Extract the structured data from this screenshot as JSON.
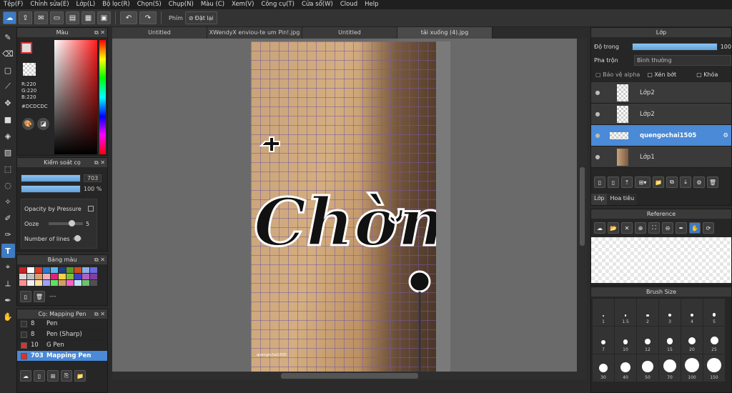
{
  "menu": [
    "Tệp(F)",
    "Chỉnh sửa(E)",
    "Lớp(L)",
    "Bộ lọc(R)",
    "Chọn(S)",
    "Chụp(N)",
    "Màu (C)",
    "Xem(V)",
    "Công cụ(T)",
    "Cửa sổ(W)",
    "Cloud",
    "Help"
  ],
  "toolbar": {
    "phim_label": "Phím",
    "reset_label": "Đặt lại"
  },
  "color_panel": {
    "title": "Màu",
    "rgb": [
      "R:220",
      "G:220",
      "B:220"
    ],
    "hex": "#DCDCDC",
    "foreground": "#dcdcdc"
  },
  "brush_control": {
    "title": "Kiểm soát cọ",
    "size": "703",
    "opacity": "100 %",
    "opacity_by_pressure": "Opacity by Pressure",
    "ooze_label": "Ooze",
    "ooze_value": "5",
    "lines_label": "Number of lines"
  },
  "palette": {
    "title": "Bảng màu",
    "colors": [
      "#cc2222",
      "#ffffff",
      "#e23c2c",
      "#2a7ad6",
      "#5fb7e8",
      "#1e3f8c",
      "#5a9a2a",
      "#c94f1a",
      "#8ab0e8",
      "#6a6ae0",
      "#d9d9d9",
      "#c0c0c0",
      "#e0a070",
      "#f0b0b0",
      "#e02080",
      "#ffd040",
      "#80c040",
      "#4040c0",
      "#b060c0",
      "#8040a0",
      "#ff9090",
      "#f0f0f0",
      "#ffe0a0",
      "#a0a0ff",
      "#60e060",
      "#d0a060",
      "#ff60c0",
      "#c0e0ff",
      "#70c070",
      "#505050"
    ],
    "dashes": "---"
  },
  "pens": {
    "title": "Cọ: Mapping Pen",
    "items": [
      {
        "size": "8",
        "name": "Pen",
        "color": "#333333"
      },
      {
        "size": "8",
        "name": "Pen (Sharp)",
        "color": "#333333"
      },
      {
        "size": "10",
        "name": "G Pen",
        "color": "#e03030"
      },
      {
        "size": "703",
        "name": "Mapping Pen",
        "color": "#e03030"
      }
    ]
  },
  "tabs": [
    "Untitled",
    "XWendyX enviou-te um Pin!.jpg",
    "Untitled",
    "tải xuống (4).jpg"
  ],
  "canvas": {
    "artwork_text": "Chờm",
    "watermark": "quengochai1505"
  },
  "layers": {
    "title": "Lớp",
    "opacity_label": "Độ trong",
    "opacity_value": "100",
    "blend_label": "Pha trộn",
    "blend_value": "Bình thường",
    "protect_alpha": "Bảo vệ alpha",
    "clip": "Xén bớt",
    "lock": "Khóa",
    "items": [
      {
        "name": "Lớp2"
      },
      {
        "name": "Lớp2"
      },
      {
        "name": "quengochai1505"
      },
      {
        "name": "Lớp1"
      }
    ],
    "tab_layer": "Lớp",
    "tab_nav": "Hoa tiêu"
  },
  "reference": {
    "title": "Reference"
  },
  "brush_size": {
    "title": "Brush Size",
    "sizes": [
      "1",
      "1.5",
      "2",
      "3",
      "4",
      "5",
      "7",
      "10",
      "12",
      "15",
      "20",
      "25",
      "30",
      "40",
      "50",
      "70",
      "100",
      "150"
    ]
  }
}
